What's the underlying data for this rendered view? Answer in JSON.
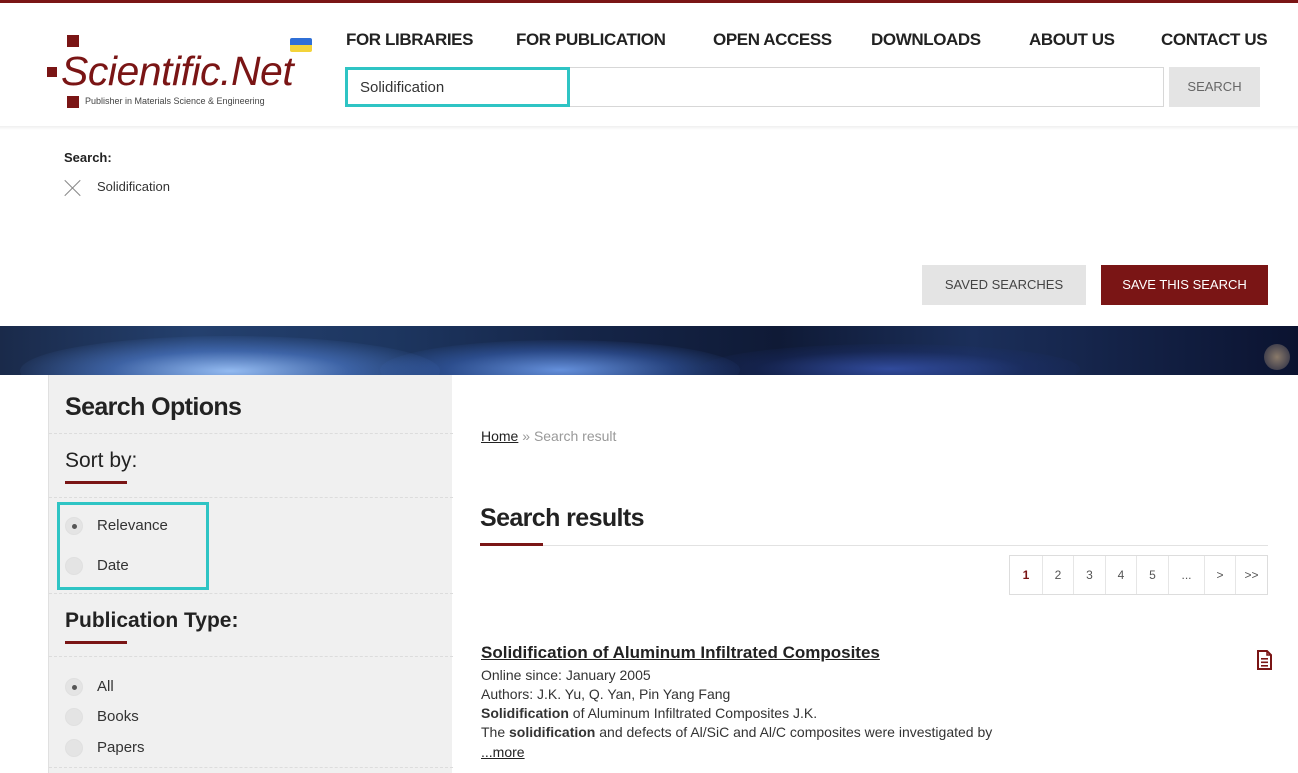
{
  "header": {
    "logo_text": "Scientific.Net",
    "logo_tagline": "Publisher in Materials Science & Engineering",
    "nav": [
      "FOR LIBRARIES",
      "FOR PUBLICATION",
      "OPEN ACCESS",
      "DOWNLOADS",
      "ABOUT US",
      "CONTACT US"
    ],
    "search_value": "Solidification",
    "search_button": "SEARCH"
  },
  "search_info": {
    "label": "Search:",
    "term": "Solidification",
    "saved_searches": "SAVED SEARCHES",
    "save_this_search": "SAVE THIS SEARCH"
  },
  "sidebar": {
    "title": "Search Options",
    "sort_heading": "Sort by:",
    "sort_options": [
      {
        "label": "Relevance",
        "selected": true
      },
      {
        "label": "Date",
        "selected": false
      }
    ],
    "pubtype_heading": "Publication Type:",
    "pubtype_options": [
      {
        "label": "All",
        "selected": true
      },
      {
        "label": "Books",
        "selected": false
      },
      {
        "label": "Papers",
        "selected": false
      }
    ]
  },
  "main": {
    "breadcrumb_home": "Home",
    "breadcrumb_sep": " » ",
    "breadcrumb_current": "Search result",
    "results_title": "Search results",
    "pagination": [
      "1",
      "2",
      "3",
      "4",
      "5",
      "...",
      ">",
      ">>"
    ],
    "results": [
      {
        "title": "Solidification of Aluminum Infiltrated Composites",
        "online_since": "Online since: January 2005",
        "authors": "Authors: J.K. Yu, Q. Yan, Pin Yang Fang",
        "snippet1_bold": "Solidification",
        "snippet1_rest": " of Aluminum Infiltrated Composites J.K.",
        "snippet2_pre": "The ",
        "snippet2_bold": "solidification",
        "snippet2_rest": " and defects of Al/SiC and Al/C composites were investigated by",
        "more": "...more"
      }
    ]
  },
  "colors": {
    "brand": "#7a1515",
    "highlight": "#2ec4c4"
  }
}
